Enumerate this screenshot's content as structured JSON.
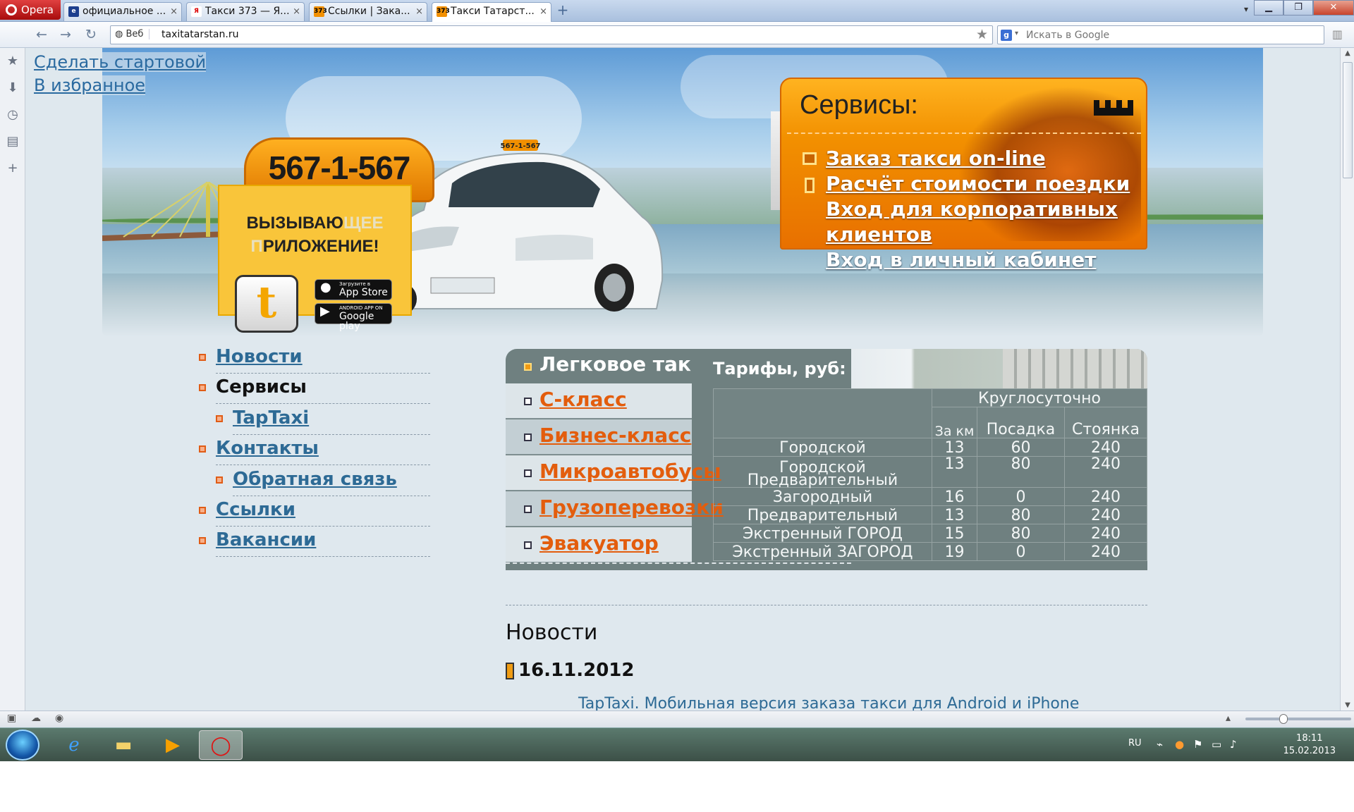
{
  "browser": {
    "menu_label": "Opera",
    "tabs": [
      {
        "title": "официальное ...",
        "icon": "ie-icon",
        "active": false
      },
      {
        "title": "Такси 373 — Я...",
        "icon": "yandex-icon",
        "active": false
      },
      {
        "title": "Ссылки | Зака...",
        "icon": "373-icon",
        "active": false
      },
      {
        "title": "Такси Татарст...",
        "icon": "373-icon",
        "active": true
      }
    ],
    "favicon_text": "373",
    "yandex_text": "Я",
    "url_site_label": "Веб",
    "url": "taxitatarstan.ru",
    "search_placeholder": "Искать в Google",
    "search_engine_icon": "g-icon"
  },
  "page": {
    "top_links": [
      "Сделать стартовой",
      "В избранное"
    ],
    "phone": "567-1-567",
    "car_sign": "567-1-567",
    "app": {
      "heading_line1_a": "ВЫЗЫВАЮ",
      "heading_line1_b": "ЩЕЕ",
      "heading_line2_a": "П",
      "heading_line2_b": "РИЛОЖЕНИЕ!",
      "logo_letter": "t",
      "appstore_small": "Загрузите в",
      "appstore_label": "App Store",
      "googleplay_small": "ANDROID APP ON",
      "googleplay_label": "Google play"
    },
    "services": {
      "title": "Сервисы:",
      "links": [
        "Заказ такси on-line",
        "Расчёт стоимости поездки",
        "Вход для корпоративных",
        "клиентов",
        "Вход в личный кабинет"
      ]
    },
    "menu": [
      {
        "label": "Новости",
        "level": 0,
        "current": false
      },
      {
        "label": "Сервисы",
        "level": 0,
        "current": true
      },
      {
        "label": "TapTaxi",
        "level": 1,
        "current": false
      },
      {
        "label": "Контакты",
        "level": 0,
        "current": false
      },
      {
        "label": "Обратная связь",
        "level": 1,
        "current": false
      },
      {
        "label": "Ссылки",
        "level": 0,
        "current": false
      },
      {
        "label": "Вакансии",
        "level": 0,
        "current": false
      }
    ],
    "tariffs": {
      "active_category": "Легковое такси",
      "title": "Тарифы, руб:",
      "categories": [
        "С-класс",
        "Бизнес-класс",
        "Микроавтобусы",
        "Грузоперевозки",
        "Эвакуатор"
      ],
      "header_group": "Круглосуточно",
      "col_km": "За км",
      "col_pickup": "Посадка",
      "col_wait": "Стоянка",
      "rows": [
        {
          "name": "Городской",
          "km": "13",
          "pickup": "60",
          "wait": "240"
        },
        {
          "name": "Городской Предварительный",
          "km": "13",
          "pickup": "80",
          "wait": "240"
        },
        {
          "name": "Загородный",
          "km": "16",
          "pickup": "0",
          "wait": "240"
        },
        {
          "name": "Предварительный",
          "km": "13",
          "pickup": "80",
          "wait": "240"
        },
        {
          "name": "Экстренный ГОРОД",
          "km": "15",
          "pickup": "80",
          "wait": "240"
        },
        {
          "name": "Экстренный ЗАГОРОД",
          "km": "19",
          "pickup": "0",
          "wait": "240"
        }
      ]
    },
    "news": {
      "title": "Новости",
      "date": "16.11.2012",
      "item": "TapTaxi. Мобильная версия заказа такси для Android и iPhone"
    }
  },
  "taskbar": {
    "lang": "RU",
    "time": "18:11",
    "date": "15.02.2013"
  },
  "colors": {
    "accent_orange": "#f29000",
    "link_blue": "#2d6a95",
    "category_orange": "#e35d0d",
    "tariff_bg": "#6f8080"
  }
}
